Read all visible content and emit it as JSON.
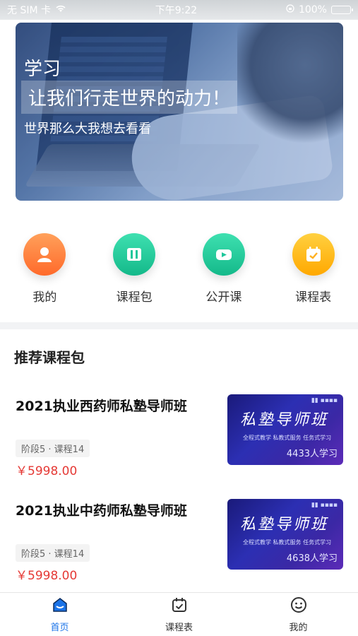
{
  "status_bar": {
    "carrier": "无 SIM 卡",
    "time": "下午9:22",
    "battery": "100%"
  },
  "banner": {
    "title": "学习",
    "slogan": "让我们行走世界的动力！",
    "subtitle": "世界那么大我想去看看"
  },
  "quick_nav": [
    {
      "label": "我的",
      "icon": "user-icon",
      "color": "#ff7a3d"
    },
    {
      "label": "课程包",
      "icon": "book-icon",
      "color": "#1ec79b"
    },
    {
      "label": "公开课",
      "icon": "video-icon",
      "color": "#1ec79b"
    },
    {
      "label": "课程表",
      "icon": "calendar-icon",
      "color": "#ffb020"
    }
  ],
  "section": {
    "title": "推荐课程包"
  },
  "courses": [
    {
      "title": "2021执业西药师私塾导师班",
      "tag": "阶段5 · 课程14",
      "price": "￥5998.00",
      "thumb_heading": "私塾导师班",
      "thumb_line": "全程式教学 私教式服务 任务式学习",
      "thumb_count": "4433人学习"
    },
    {
      "title": "2021执业中药师私塾导师班",
      "tag": "阶段5 · 课程14",
      "price": "￥5998.00",
      "thumb_heading": "私塾导师班",
      "thumb_line": "全程式教学 私教式服务 任务式学习",
      "thumb_count": "4638人学习"
    }
  ],
  "tab_bar": [
    {
      "label": "首页",
      "icon": "home-icon"
    },
    {
      "label": "课程表",
      "icon": "calendar-icon"
    },
    {
      "label": "我的",
      "icon": "smile-icon"
    }
  ],
  "colors": {
    "accent": "#1a73e8",
    "price": "#e53935"
  }
}
